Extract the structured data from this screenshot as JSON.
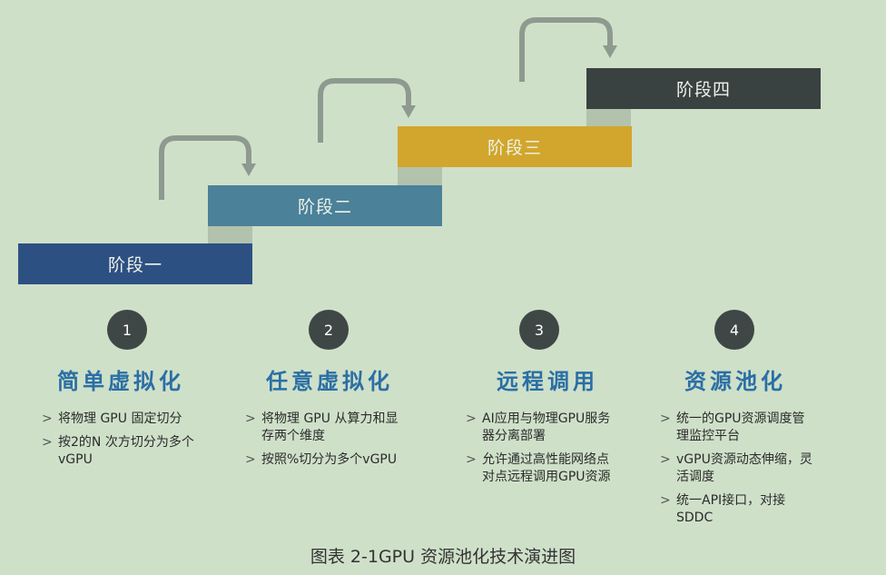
{
  "stages": [
    {
      "label": "阶段一",
      "color": "#2d5082"
    },
    {
      "label": "阶段二",
      "color": "#4b8199"
    },
    {
      "label": "阶段三",
      "color": "#d2a62d"
    },
    {
      "label": "阶段四",
      "color": "#3a4141"
    }
  ],
  "columns": [
    {
      "number": "1",
      "title": "简单虚拟化",
      "bullets": [
        "将物理 GPU 固定切分",
        "按2的N 次方切分为多个vGPU"
      ]
    },
    {
      "number": "2",
      "title": "任意虚拟化",
      "bullets": [
        "将物理 GPU 从算力和显存两个维度",
        "按照%切分为多个vGPU"
      ]
    },
    {
      "number": "3",
      "title": "远程调用",
      "bullets": [
        "AI应用与物理GPU服务器分离部署",
        "允许通过高性能网络点对点远程调用GPU资源"
      ]
    },
    {
      "number": "4",
      "title": "资源池化",
      "bullets": [
        "统一的GPU资源调度管理监控平台",
        "vGPU资源动态伸缩，灵活调度",
        "统一API接口，对接SDDC"
      ]
    }
  ],
  "bullet_marker": ">",
  "caption": "图表 2-1GPU 资源池化技术演进图",
  "colors": {
    "arrow": "#8e9a8f",
    "riser": "#b2c2ad",
    "title": "#2a6fa5",
    "circle": "#3f4746"
  }
}
